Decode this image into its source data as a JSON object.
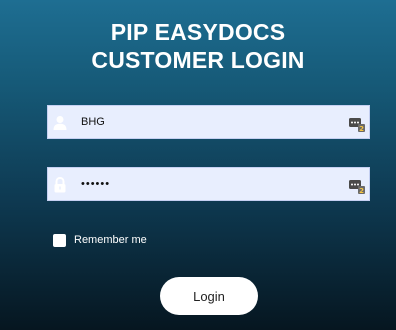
{
  "header": {
    "title_line1": "PIP EASYDOCS",
    "title_line2": "CUSTOMER LOGIN"
  },
  "form": {
    "username": {
      "value": "BHG",
      "lead_icon": "user-icon",
      "trailing_icon": "password-manager-icon"
    },
    "password": {
      "value": "••••••",
      "lead_icon": "lock-icon",
      "trailing_icon": "password-manager-icon"
    },
    "remember_me": {
      "label": "Remember me",
      "checked": false
    },
    "login_button": {
      "label": "Login"
    }
  },
  "colors": {
    "gradient_top": "#1e6e92",
    "gradient_bottom": "#061620",
    "field_bg": "#e8eefe",
    "text_on_dark": "#ffffff"
  }
}
